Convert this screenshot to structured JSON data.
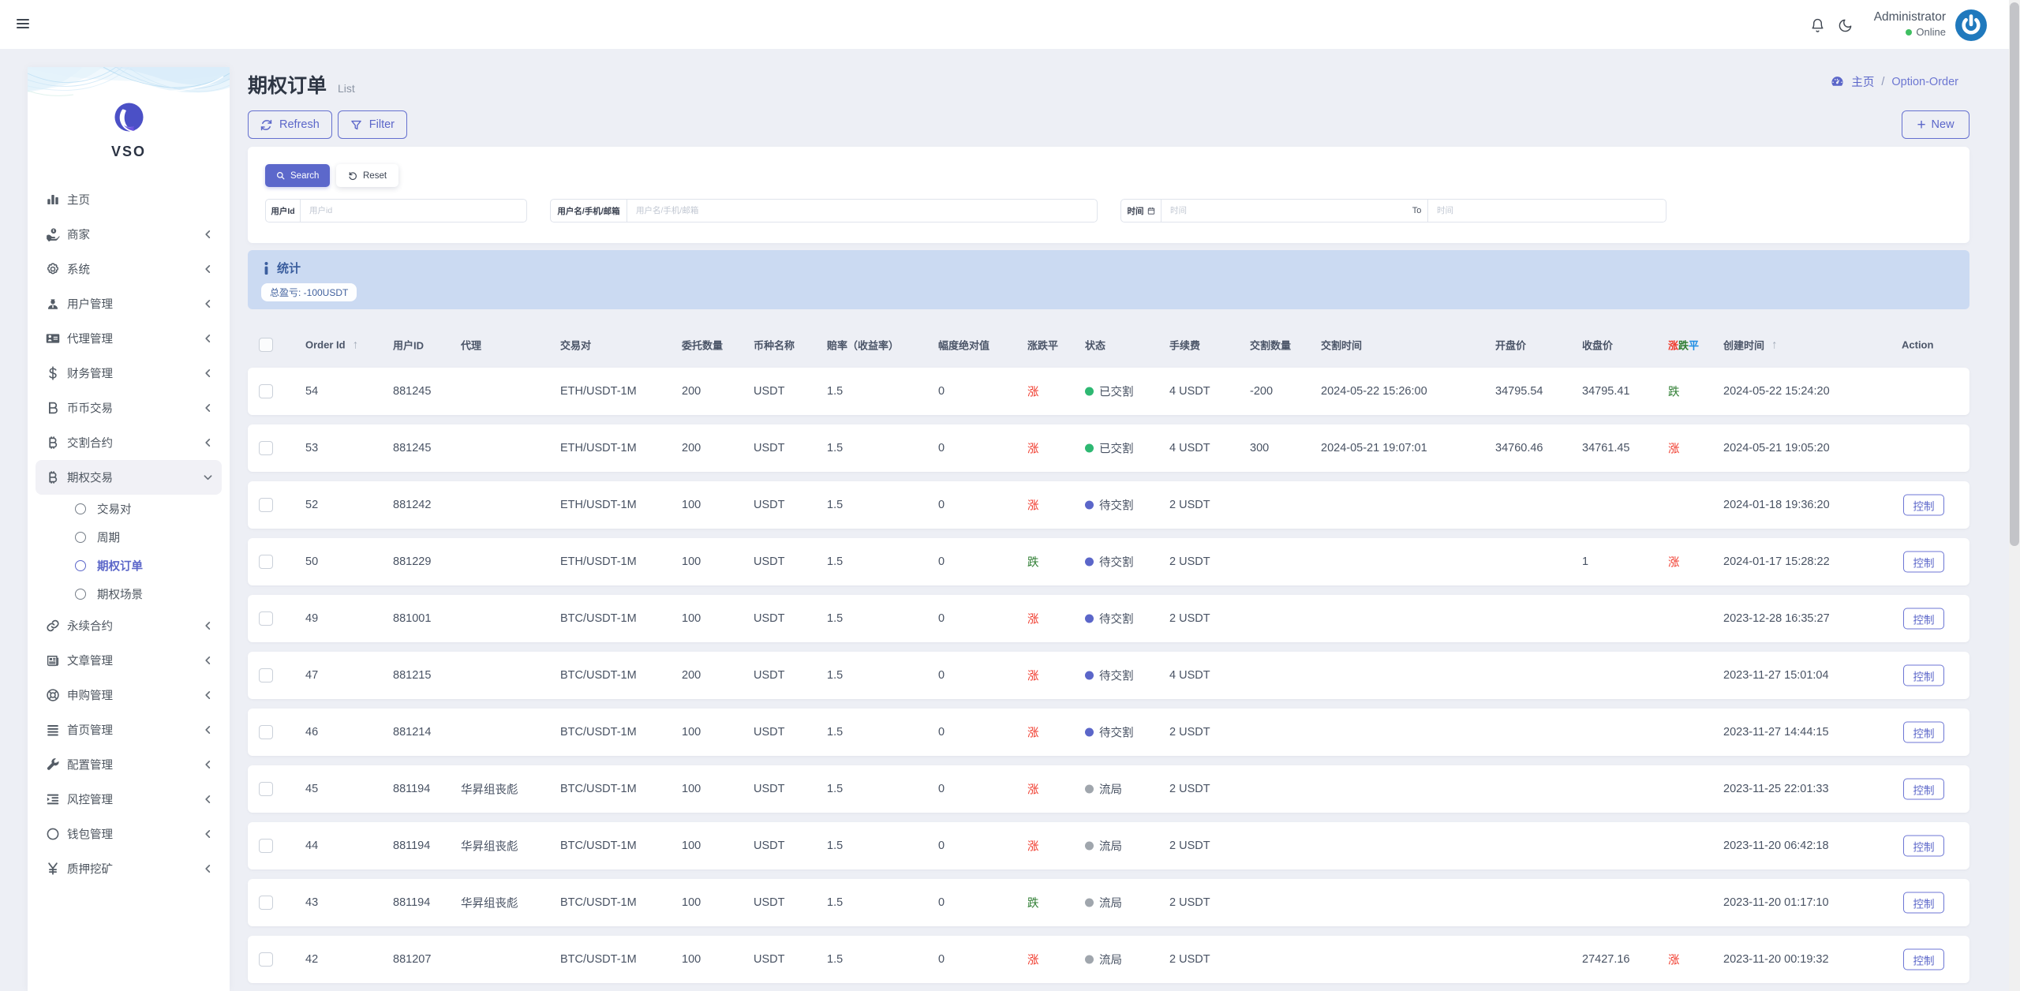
{
  "topbar": {
    "icons": [
      "hamburger-menu-icon",
      "notifications-bell-icon",
      "dark-mode-moon-icon"
    ],
    "user_name": "Administrator",
    "user_status": "Online",
    "online_dot_color": "#3fbf61",
    "avatar_icon": "power-icon",
    "avatar_color": "#2079bd"
  },
  "sidebar": {
    "brand": "VSO",
    "items": [
      {
        "icon": "chart-bar-icon",
        "label": "主页",
        "chevron": false
      },
      {
        "icon": "merchant-icon",
        "label": "商家",
        "chevron": true
      },
      {
        "icon": "gear-icon",
        "label": "系统",
        "chevron": true
      },
      {
        "icon": "user-icon",
        "label": "用户管理",
        "chevron": true
      },
      {
        "icon": "id-card-icon",
        "label": "代理管理",
        "chevron": true
      },
      {
        "icon": "dollar-icon",
        "label": "财务管理",
        "chevron": true
      },
      {
        "icon": "letter-b-icon",
        "label": "币币交易",
        "chevron": true
      },
      {
        "icon": "bitcoin-icon",
        "label": "交割合约",
        "chevron": true
      },
      {
        "icon": "bitcoin-icon",
        "label": "期权交易",
        "chevron": true,
        "expanded": true,
        "active_parent": true,
        "children": [
          {
            "label": "交易对",
            "active": false
          },
          {
            "label": "周期",
            "active": false
          },
          {
            "label": "期权订单",
            "active": true
          },
          {
            "label": "期权场景",
            "active": false
          }
        ]
      },
      {
        "icon": "link-icon",
        "label": "永续合约",
        "chevron": true
      },
      {
        "icon": "newspaper-icon",
        "label": "文章管理",
        "chevron": true
      },
      {
        "icon": "life-ring-icon",
        "label": "申购管理",
        "chevron": true
      },
      {
        "icon": "bars-icon",
        "label": "首页管理",
        "chevron": true
      },
      {
        "icon": "wrench-icon",
        "label": "配置管理",
        "chevron": true
      },
      {
        "icon": "outdent-icon",
        "label": "风控管理",
        "chevron": true
      },
      {
        "icon": "circle-icon",
        "label": "钱包管理",
        "chevron": true
      },
      {
        "icon": "yen-icon",
        "label": "质押挖矿",
        "chevron": true
      }
    ]
  },
  "page": {
    "title": "期权订单",
    "subtitle": "List",
    "breadcrumb_icon": "dashboard-gauge-icon",
    "breadcrumb_home": "主页",
    "breadcrumb_separator": "/",
    "breadcrumb_current": "Option-Order",
    "refresh_label": "Refresh",
    "refresh_icon": "refresh-icon",
    "filter_label": "Filter",
    "filter_icon": "filter-funnel-icon",
    "new_label": "New",
    "new_icon": "plus-icon",
    "accent_color": "#5b66c9"
  },
  "filter": {
    "search_label": "Search",
    "search_icon": "search-icon",
    "search_button_color": "#5c68cb",
    "reset_label": "Reset",
    "reset_icon": "reset-icon",
    "time_icon": "calendar-icon",
    "user_id_label": "用户Id",
    "user_id_placeholder": "用户id",
    "user_name_label": "用户名/手机/邮箱",
    "user_name_placeholder": "用户名/手机/邮箱",
    "time_label": "时间",
    "time_placeholder": "时间",
    "to_label": "To"
  },
  "stats": {
    "icon": "info-icon",
    "title": "统计",
    "total_pl": "总盈亏: -100USDT",
    "background_color": "#cbdaf2"
  },
  "table": {
    "columns": [
      {
        "label": "Order Id",
        "sort": true
      },
      {
        "label": "用户ID"
      },
      {
        "label": "代理"
      },
      {
        "label": "交易对"
      },
      {
        "label": "委托数量"
      },
      {
        "label": "币种名称"
      },
      {
        "label": "赔率（收益率）"
      },
      {
        "label": "幅度绝对值"
      },
      {
        "label": "涨跌平"
      },
      {
        "label": "状态"
      },
      {
        "label": "手续费"
      },
      {
        "label": "交割数量"
      },
      {
        "label": "交割时间"
      },
      {
        "label": "开盘价"
      },
      {
        "label": "收盘价"
      },
      {
        "label": "涨跌平",
        "colored": true
      },
      {
        "label": "创建时间",
        "sort": true
      },
      {
        "label": "Action"
      }
    ],
    "action_button": "控制",
    "sort_icon": "sort-ascending-icon",
    "direction_colors": {
      "red": "#f03a2c",
      "green": "#2e7d32"
    },
    "status_dot_colors": {
      "green": "#2eb872",
      "blue": "#5b66c9",
      "gray": "#a0a6ad"
    },
    "rows": [
      {
        "id": "54",
        "user_id": "881245",
        "agent": "",
        "pair": "ETH/USDT-1M",
        "amount": "200",
        "coin": "USDT",
        "odds": "1.5",
        "amplitude": "0",
        "direction": "涨",
        "direction_color": "red",
        "status": "已交割",
        "status_dot": "green",
        "fee": "4 USDT",
        "delivery_qty": "-200",
        "delivery_time": "2024-05-22 15:26:00",
        "open_price": "34795.54",
        "close_price": "34795.41",
        "result": "跌",
        "result_color": "green",
        "created_at": "2024-05-22 15:24:20",
        "has_action": false
      },
      {
        "id": "53",
        "user_id": "881245",
        "agent": "",
        "pair": "ETH/USDT-1M",
        "amount": "200",
        "coin": "USDT",
        "odds": "1.5",
        "amplitude": "0",
        "direction": "涨",
        "direction_color": "red",
        "status": "已交割",
        "status_dot": "green",
        "fee": "4 USDT",
        "delivery_qty": "300",
        "delivery_time": "2024-05-21 19:07:01",
        "open_price": "34760.46",
        "close_price": "34761.45",
        "result": "涨",
        "result_color": "red",
        "created_at": "2024-05-21 19:05:20",
        "has_action": false
      },
      {
        "id": "52",
        "user_id": "881242",
        "agent": "",
        "pair": "ETH/USDT-1M",
        "amount": "100",
        "coin": "USDT",
        "odds": "1.5",
        "amplitude": "0",
        "direction": "涨",
        "direction_color": "red",
        "status": "待交割",
        "status_dot": "blue",
        "fee": "2 USDT",
        "delivery_qty": "",
        "delivery_time": "",
        "open_price": "",
        "close_price": "",
        "result": "",
        "result_color": "",
        "created_at": "2024-01-18 19:36:20",
        "has_action": true
      },
      {
        "id": "50",
        "user_id": "881229",
        "agent": "",
        "pair": "ETH/USDT-1M",
        "amount": "100",
        "coin": "USDT",
        "odds": "1.5",
        "amplitude": "0",
        "direction": "跌",
        "direction_color": "green",
        "status": "待交割",
        "status_dot": "blue",
        "fee": "2 USDT",
        "delivery_qty": "",
        "delivery_time": "",
        "open_price": "",
        "close_price": "1",
        "result": "涨",
        "result_color": "red",
        "created_at": "2024-01-17 15:28:22",
        "has_action": true
      },
      {
        "id": "49",
        "user_id": "881001",
        "agent": "",
        "pair": "BTC/USDT-1M",
        "amount": "100",
        "coin": "USDT",
        "odds": "1.5",
        "amplitude": "0",
        "direction": "涨",
        "direction_color": "red",
        "status": "待交割",
        "status_dot": "blue",
        "fee": "2 USDT",
        "delivery_qty": "",
        "delivery_time": "",
        "open_price": "",
        "close_price": "",
        "result": "",
        "result_color": "",
        "created_at": "2023-12-28 16:35:27",
        "has_action": true
      },
      {
        "id": "47",
        "user_id": "881215",
        "agent": "",
        "pair": "BTC/USDT-1M",
        "amount": "200",
        "coin": "USDT",
        "odds": "1.5",
        "amplitude": "0",
        "direction": "涨",
        "direction_color": "red",
        "status": "待交割",
        "status_dot": "blue",
        "fee": "4 USDT",
        "delivery_qty": "",
        "delivery_time": "",
        "open_price": "",
        "close_price": "",
        "result": "",
        "result_color": "",
        "created_at": "2023-11-27 15:01:04",
        "has_action": true
      },
      {
        "id": "46",
        "user_id": "881214",
        "agent": "",
        "pair": "BTC/USDT-1M",
        "amount": "100",
        "coin": "USDT",
        "odds": "1.5",
        "amplitude": "0",
        "direction": "涨",
        "direction_color": "red",
        "status": "待交割",
        "status_dot": "blue",
        "fee": "2 USDT",
        "delivery_qty": "",
        "delivery_time": "",
        "open_price": "",
        "close_price": "",
        "result": "",
        "result_color": "",
        "created_at": "2023-11-27 14:44:15",
        "has_action": true
      },
      {
        "id": "45",
        "user_id": "881194",
        "agent": "华昇组丧彪",
        "pair": "BTC/USDT-1M",
        "amount": "100",
        "coin": "USDT",
        "odds": "1.5",
        "amplitude": "0",
        "direction": "涨",
        "direction_color": "red",
        "status": "流局",
        "status_dot": "gray",
        "fee": "2 USDT",
        "delivery_qty": "",
        "delivery_time": "",
        "open_price": "",
        "close_price": "",
        "result": "",
        "result_color": "",
        "created_at": "2023-11-25 22:01:33",
        "has_action": true
      },
      {
        "id": "44",
        "user_id": "881194",
        "agent": "华昇组丧彪",
        "pair": "BTC/USDT-1M",
        "amount": "100",
        "coin": "USDT",
        "odds": "1.5",
        "amplitude": "0",
        "direction": "涨",
        "direction_color": "red",
        "status": "流局",
        "status_dot": "gray",
        "fee": "2 USDT",
        "delivery_qty": "",
        "delivery_time": "",
        "open_price": "",
        "close_price": "",
        "result": "",
        "result_color": "",
        "created_at": "2023-11-20 06:42:18",
        "has_action": true
      },
      {
        "id": "43",
        "user_id": "881194",
        "agent": "华昇组丧彪",
        "pair": "BTC/USDT-1M",
        "amount": "100",
        "coin": "USDT",
        "odds": "1.5",
        "amplitude": "0",
        "direction": "跌",
        "direction_color": "green",
        "status": "流局",
        "status_dot": "gray",
        "fee": "2 USDT",
        "delivery_qty": "",
        "delivery_time": "",
        "open_price": "",
        "close_price": "",
        "result": "",
        "result_color": "",
        "created_at": "2023-11-20 01:17:10",
        "has_action": true
      },
      {
        "id": "42",
        "user_id": "881207",
        "agent": "",
        "pair": "BTC/USDT-1M",
        "amount": "100",
        "coin": "USDT",
        "odds": "1.5",
        "amplitude": "0",
        "direction": "涨",
        "direction_color": "red",
        "status": "流局",
        "status_dot": "gray",
        "fee": "2 USDT",
        "delivery_qty": "",
        "delivery_time": "",
        "open_price": "",
        "close_price": "27427.16",
        "result": "涨",
        "result_color": "red",
        "created_at": "2023-11-20 00:19:32",
        "has_action": true
      }
    ]
  }
}
